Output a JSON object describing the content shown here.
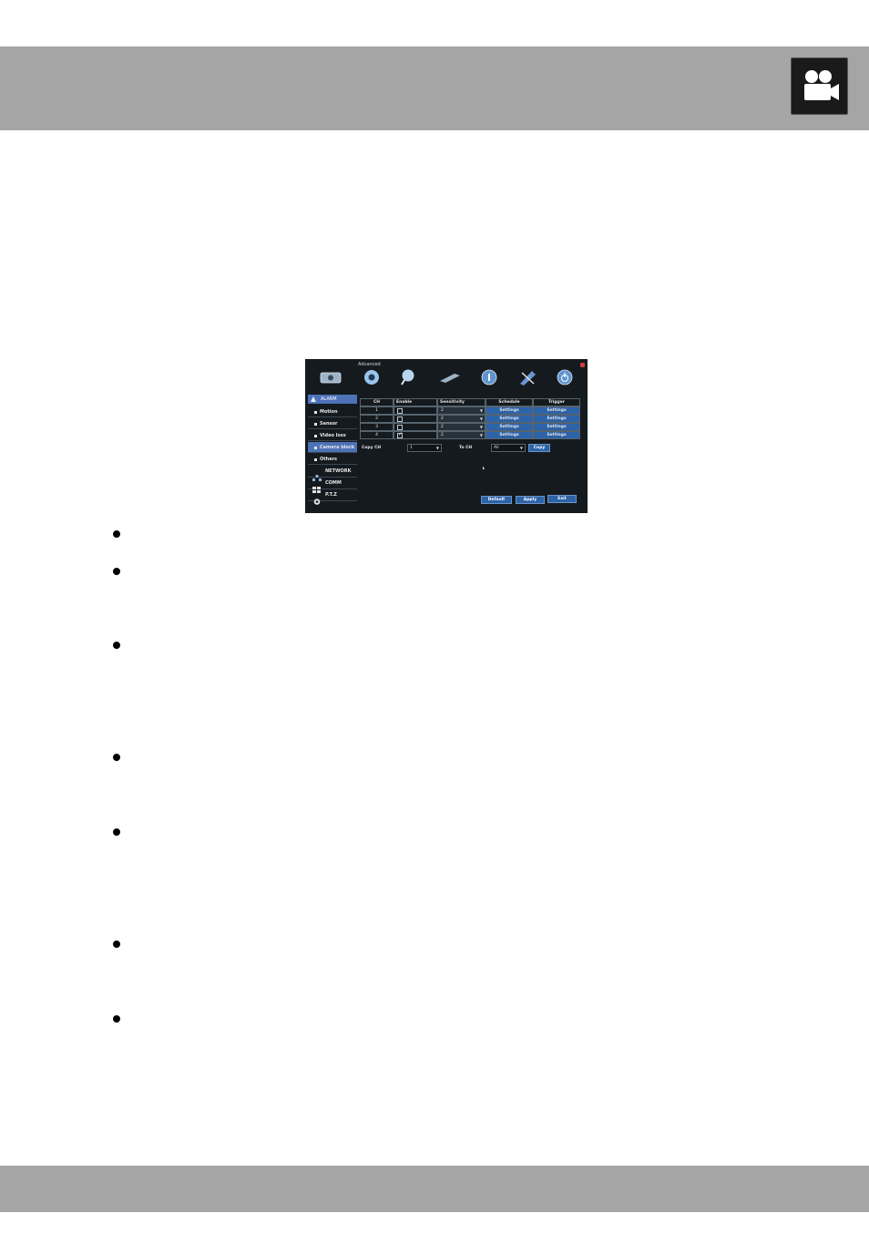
{
  "header": {
    "icon": "video-camera-icon"
  },
  "screenshot": {
    "window_title": "Advanced",
    "tabs": [
      {
        "icon": "record-icon"
      },
      {
        "icon": "gear-icon"
      },
      {
        "icon": "search-icon"
      },
      {
        "icon": "hdd-icon"
      },
      {
        "icon": "info-icon"
      },
      {
        "icon": "tools-icon"
      },
      {
        "icon": "power-icon"
      }
    ],
    "sidebar": {
      "section_alarm": "ALARM",
      "items": [
        "Motion",
        "Sensor",
        "Video loss",
        "Camera block",
        "Others"
      ],
      "sections": [
        "NETWORK",
        "COMM",
        "P.T.Z"
      ]
    },
    "table": {
      "headers": [
        "CH",
        "Enable",
        "Sensitivity",
        "Schedule",
        "Trigger"
      ],
      "rows": [
        {
          "ch": "1",
          "enabled": false,
          "sensitivity": "2",
          "schedule": "Settings",
          "trigger": "Settings"
        },
        {
          "ch": "2",
          "enabled": false,
          "sensitivity": "2",
          "schedule": "Settings",
          "trigger": "Settings"
        },
        {
          "ch": "3",
          "enabled": false,
          "sensitivity": "2",
          "schedule": "Settings",
          "trigger": "Settings"
        },
        {
          "ch": "4",
          "enabled": true,
          "sensitivity": "2",
          "schedule": "Settings",
          "trigger": "Settings"
        }
      ]
    },
    "copy": {
      "label": "Copy CH",
      "from_value": "1",
      "to_label": "To CH",
      "to_value": "All",
      "button": "Copy"
    },
    "footer": {
      "default": "Default",
      "apply": "Apply",
      "exit": "Exit"
    }
  },
  "bullets_count": 7
}
